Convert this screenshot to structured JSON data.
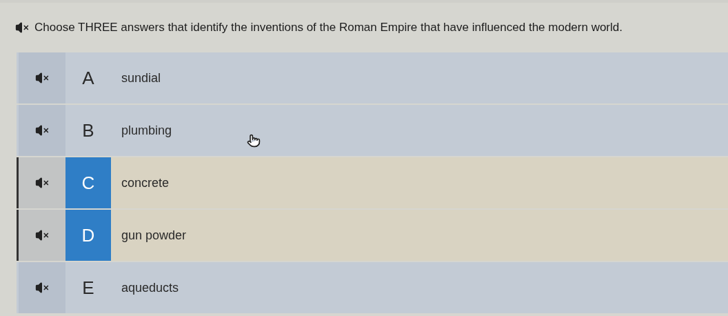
{
  "question": {
    "text": "Choose THREE answers that identify the inventions of the Roman Empire that have influenced the modern world."
  },
  "options": [
    {
      "letter": "A",
      "text": "sundial",
      "selected": false
    },
    {
      "letter": "B",
      "text": "plumbing",
      "selected": false
    },
    {
      "letter": "C",
      "text": "concrete",
      "selected": true
    },
    {
      "letter": "D",
      "text": "gun powder",
      "selected": true
    },
    {
      "letter": "E",
      "text": "aqueducts",
      "selected": false
    }
  ]
}
